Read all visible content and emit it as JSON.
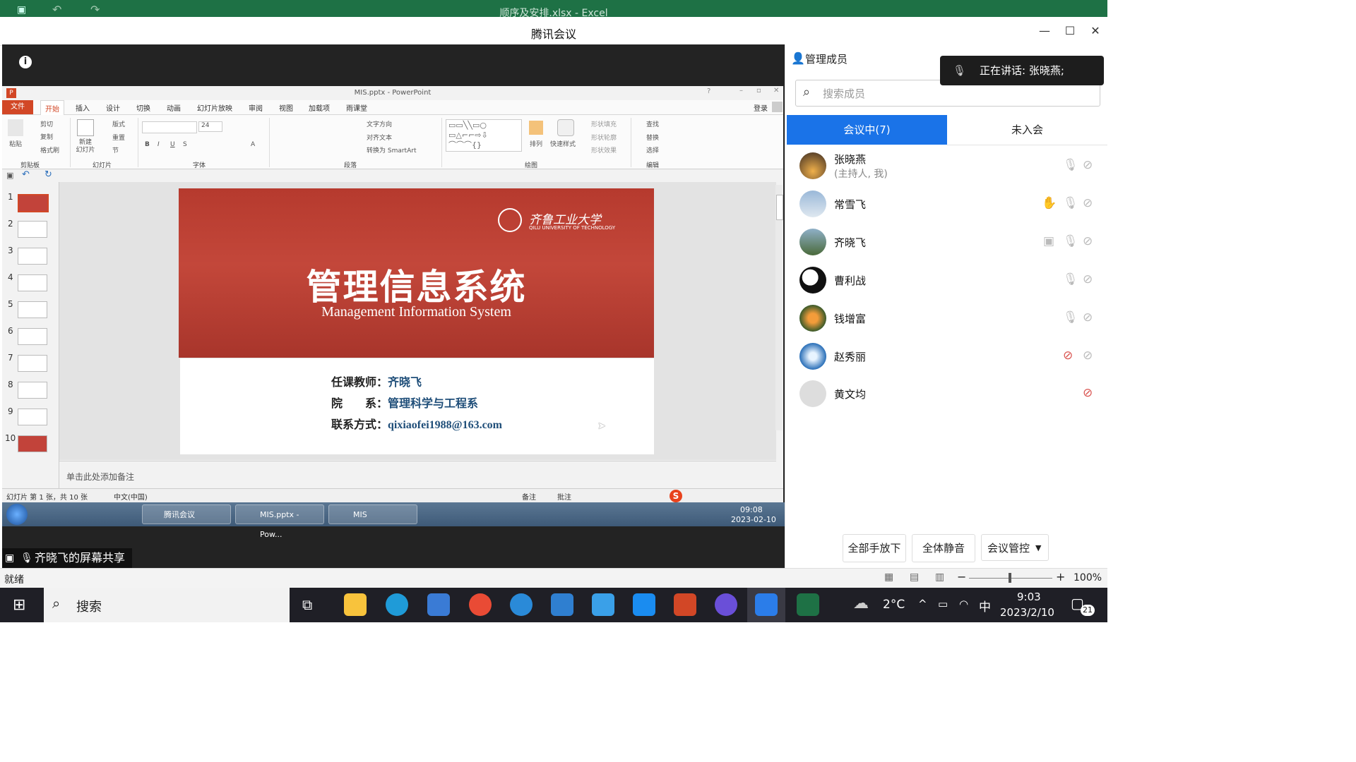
{
  "excel": {
    "title": "顺序及安排.xlsx - Excel",
    "status": "就绪",
    "zoom": "100%"
  },
  "meeting": {
    "title": "腾讯会议",
    "panel_title": "管理成员",
    "speaking": "正在讲话: 张晓燕;",
    "search_placeholder": "搜索成员",
    "tab_in": "会议中(7)",
    "tab_out": "未入会",
    "members": [
      {
        "name": "张晓燕",
        "sub": "(主持人, 我)"
      },
      {
        "name": "常雪飞",
        "sub": ""
      },
      {
        "name": "齐晓飞",
        "sub": ""
      },
      {
        "name": "曹利战",
        "sub": ""
      },
      {
        "name": "钱增富",
        "sub": ""
      },
      {
        "name": "赵秀丽",
        "sub": ""
      },
      {
        "name": "黄文均",
        "sub": ""
      }
    ],
    "buttons": {
      "lower_all": "全部手放下",
      "mute_all": "全体静音",
      "control": "会议管控"
    },
    "sharing_label": "齐晓飞的屏幕共享"
  },
  "ppt": {
    "window_title": "MIS.pptx - PowerPoint",
    "login": "登录",
    "tabs": [
      "文件",
      "开始",
      "插入",
      "设计",
      "切换",
      "动画",
      "幻灯片放映",
      "审阅",
      "视图",
      "加载项",
      "雨课堂"
    ],
    "groups": [
      "剪贴板",
      "幻灯片",
      "字体",
      "段落",
      "绘图",
      "编辑"
    ],
    "ribbon": {
      "paste": "粘贴",
      "cut": "剪切",
      "copy": "复制",
      "format": "格式刷",
      "new_slide": "新建\n幻灯片",
      "layout": "版式",
      "reset": "重置",
      "section": "节",
      "font_size": "24",
      "text_dir": "文字方向",
      "align_text": "对齐文本",
      "smartart": "转换为 SmartArt",
      "arrange": "排列",
      "quick_style": "快速样式",
      "shape_fill": "形状填充",
      "shape_outline": "形状轮廓",
      "shape_effect": "形状效果",
      "find": "查找",
      "replace": "替换",
      "select": "选择"
    },
    "slide_numbers": [
      "1",
      "2",
      "3",
      "4",
      "5",
      "6",
      "7",
      "8",
      "9",
      "10"
    ],
    "slide": {
      "university": "齐鲁工业大学",
      "university_en": "QILU UNIVERSITY OF TECHNOLOGY",
      "title": "管理信息系统",
      "subtitle": "Management Information System",
      "teacher_label": "任课教师：",
      "teacher": "齐晓飞",
      "dept_label": "院　　系：",
      "dept": "管理科学与工程系",
      "contact_label": "联系方式：",
      "contact": "qixiaofei1988@163.com"
    },
    "notes_placeholder": "单击此处添加备注",
    "status_left": "幻灯片 第 1 张，共 10 张",
    "status_lang": "中文(中国)",
    "status_notes": "备注",
    "status_comments": "批注"
  },
  "win7": {
    "tasks": [
      "腾讯会议",
      "MIS.pptx - Pow...",
      "MIS"
    ],
    "time": "09:08",
    "date": "2023-02-10"
  },
  "taskbar": {
    "search": "搜索",
    "weather": "2°C",
    "ime": "中",
    "time": "9:03",
    "date": "2023/2/10",
    "notif": "21"
  }
}
